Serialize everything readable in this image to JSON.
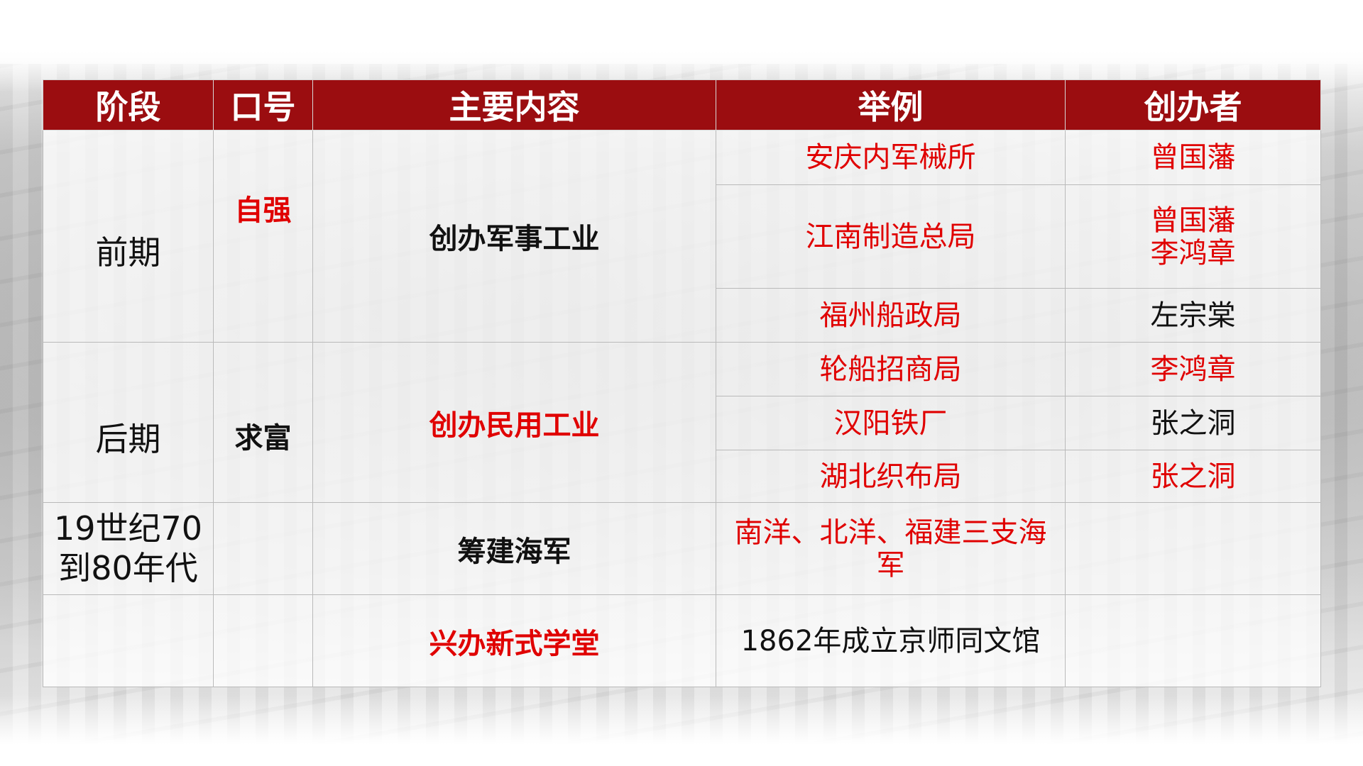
{
  "headers": {
    "stage": "阶段",
    "slogan": "口号",
    "content": "主要内容",
    "example": "举例",
    "founder": "创办者"
  },
  "early": {
    "stage": "前期",
    "slogan": "自强",
    "content": "创办军事工业",
    "rows": [
      {
        "example": "安庆内军械所",
        "founder": "曾国藩"
      },
      {
        "example": "江南制造总局",
        "founder_line1": "曾国藩",
        "founder_line2": "李鸿章"
      },
      {
        "example": "福州船政局",
        "founder": "左宗棠"
      }
    ]
  },
  "late": {
    "stage": "后期",
    "slogan": "求富",
    "content": "创办民用工业",
    "rows": [
      {
        "example": "轮船招商局",
        "founder": "李鸿章"
      },
      {
        "example": "汉阳铁厂",
        "founder": "张之洞"
      },
      {
        "example": "湖北织布局",
        "founder": "张之洞"
      }
    ]
  },
  "navy": {
    "stage_line1": "19世纪70",
    "stage_line2": "到80年代",
    "content": "筹建海军",
    "example": "南洋、北洋、福建三支海军"
  },
  "school": {
    "content": "兴办新式学堂",
    "example": "1862年成立京师同文馆"
  },
  "colors": {
    "header_bg": "#9b0d10",
    "accent_red": "#e00000"
  }
}
